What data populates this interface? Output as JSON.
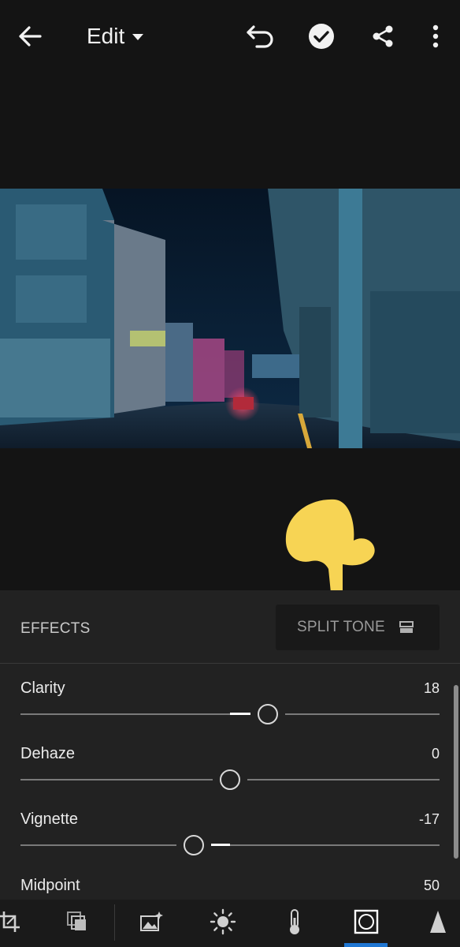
{
  "header": {
    "title": "Edit",
    "icons": [
      "back-arrow-icon",
      "undo-icon",
      "checkmark-icon",
      "share-icon",
      "more-vertical-icon"
    ]
  },
  "photo": {
    "subject": "night city street with buildings and car headlights"
  },
  "panel": {
    "section_label": "EFFECTS",
    "split_tone_label": "SPLIT TONE",
    "sliders": [
      {
        "label": "Clarity",
        "value": "18"
      },
      {
        "label": "Dehaze",
        "value": "0"
      },
      {
        "label": "Vignette",
        "value": "-17"
      },
      {
        "label": "Midpoint",
        "value": "50"
      }
    ]
  },
  "toolbar": {
    "icons": [
      "crop-icon",
      "presets-icon",
      "auto-enhance-icon",
      "light-icon",
      "color-temperature-icon",
      "effects-icon",
      "detail-icon"
    ],
    "active": "effects-icon"
  },
  "colors": {
    "accent": "#1f76d2",
    "panel": "#222222",
    "hand": "#f7d454"
  }
}
